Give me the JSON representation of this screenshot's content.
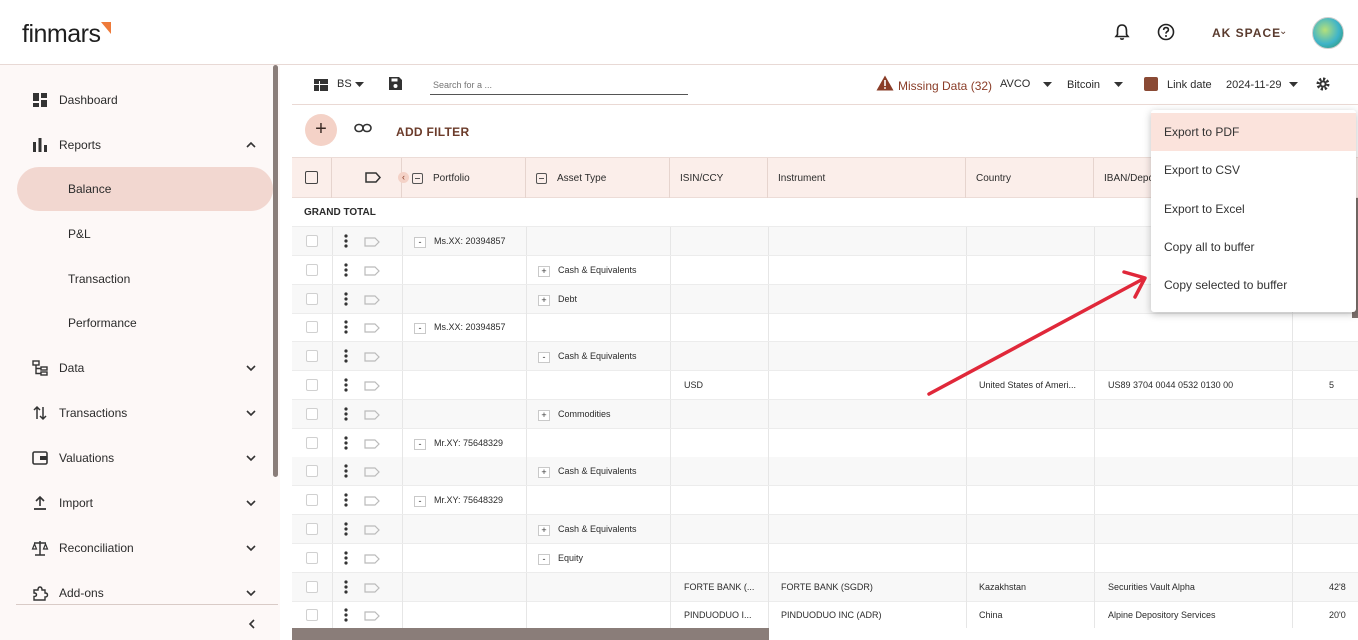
{
  "header": {
    "logo_text": "finmars",
    "space_label": "AK SPACE"
  },
  "sidebar": {
    "items": [
      {
        "label": "Dashboard"
      },
      {
        "label": "Reports"
      },
      {
        "label": "Balance"
      },
      {
        "label": "P&L"
      },
      {
        "label": "Transaction"
      },
      {
        "label": "Performance"
      },
      {
        "label": "Data"
      },
      {
        "label": "Transactions"
      },
      {
        "label": "Valuations"
      },
      {
        "label": "Import"
      },
      {
        "label": "Reconciliation"
      },
      {
        "label": "Add-ons"
      }
    ]
  },
  "toolbar": {
    "layout_label": "BS",
    "search_placeholder": "Search for a ...",
    "missing_data": "Missing Data (32)",
    "cost_method": "AVCO",
    "currency": "Bitcoin",
    "link_date_label": "Link date",
    "date": "2024-11-29"
  },
  "filter_bar": {
    "add_filter": "ADD FILTER"
  },
  "grid": {
    "columns": [
      "Portfolio",
      "Asset Type",
      "ISIN/CCY",
      "Instrument",
      "Country",
      "IBAN/Depo"
    ],
    "grand_total": "GRAND TOTAL",
    "rows": [
      {
        "level": "portfolio",
        "toggle": "-",
        "text": "Ms.XX: 20394857"
      },
      {
        "level": "asset",
        "toggle": "+",
        "text": "Cash & Equivalents"
      },
      {
        "level": "asset",
        "toggle": "+",
        "text": "Debt"
      },
      {
        "level": "portfolio",
        "toggle": "-",
        "text": "Ms.XX: 20394857"
      },
      {
        "level": "asset",
        "toggle": "-",
        "text": "Cash & Equivalents"
      },
      {
        "level": "data",
        "isin": "USD",
        "instrument": "",
        "country": "United States of Ameri...",
        "iban": "US89 3704 0044 0532 0130 00",
        "extra": "5"
      },
      {
        "level": "asset",
        "toggle": "+",
        "text": "Commodities"
      },
      {
        "level": "portfolio",
        "toggle": "-",
        "text": "Mr.XY: 75648329"
      },
      {
        "level": "asset",
        "toggle": "+",
        "text": "Cash & Equivalents"
      },
      {
        "level": "portfolio",
        "toggle": "-",
        "text": "Mr.XY: 75648329"
      },
      {
        "level": "asset",
        "toggle": "+",
        "text": "Cash & Equivalents"
      },
      {
        "level": "asset",
        "toggle": "-",
        "text": "Equity"
      },
      {
        "level": "data",
        "isin": "FORTE BANK (...",
        "instrument": "FORTE BANK (SGDR)",
        "country": "Kazakhstan",
        "iban": "Securities Vault Alpha",
        "extra": "42'8"
      },
      {
        "level": "data",
        "isin": "PINDUODUO I...",
        "instrument": "PINDUODUO INC (ADR)",
        "country": "China",
        "iban": "Alpine Depository Services",
        "extra": "20'0"
      }
    ]
  },
  "export_menu": {
    "items": [
      "Export to PDF",
      "Export to CSV",
      "Export to Excel",
      "Copy all to buffer",
      "Copy selected to buffer"
    ]
  },
  "colors": {
    "accent": "#f4d2c7",
    "brand_orange": "#ee7a3a",
    "brown": "#6b3b2a",
    "annotation_arrow": "#e0283a"
  }
}
